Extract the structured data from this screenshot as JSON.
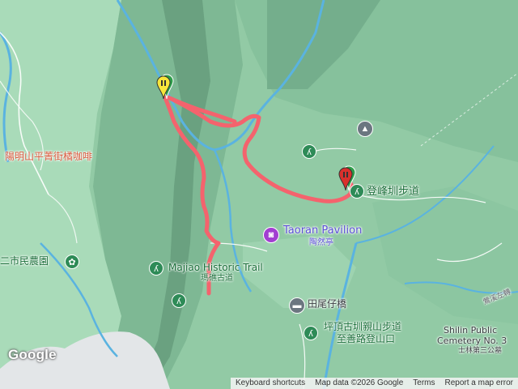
{
  "colors": {
    "route": "#f4636d",
    "water": "#5ab3e0",
    "forest_light": "#9ed4b1",
    "forest_dark": "#6fa886",
    "label_red": "#d9583b",
    "label_blue": "#5b4fd6",
    "label_green": "#1b6f3a",
    "label_dark": "#3c4043"
  },
  "labels": {
    "cafe": "陽明山平菁街橘咖啡",
    "farm": "二市民農園",
    "majiao_trail": "Majiao Historic Trail",
    "majiao_trail_zh": "瑪礁古道",
    "taoran": "Taoran Pavilion",
    "taoran_zh": "陶然亭",
    "dengfeng": "登峰圳步道",
    "tianweizai": "田尾仔橋",
    "pingding_1": "坪頂古圳親山步道",
    "pingding_2": "至善路登山口",
    "cemetery_1": "Shilin Public",
    "cemetery_2": "Cemetery No. 3",
    "cemetery_3": "士林第三公墓",
    "road_label": "鶯溪左轉"
  },
  "icons": {
    "start_marker": "yellow-pin-icon",
    "end_marker": "red-pin-icon",
    "trail_poi": "hiking-icon",
    "school": "school-icon",
    "pavilion": "camera-icon",
    "bridge": "bridge-icon",
    "farm": "flower-icon"
  },
  "attribution": {
    "logo": "Google",
    "shortcuts": "Keyboard shortcuts",
    "map_data": "Map data ©2026 Google",
    "terms": "Terms",
    "report": "Report a map error"
  }
}
